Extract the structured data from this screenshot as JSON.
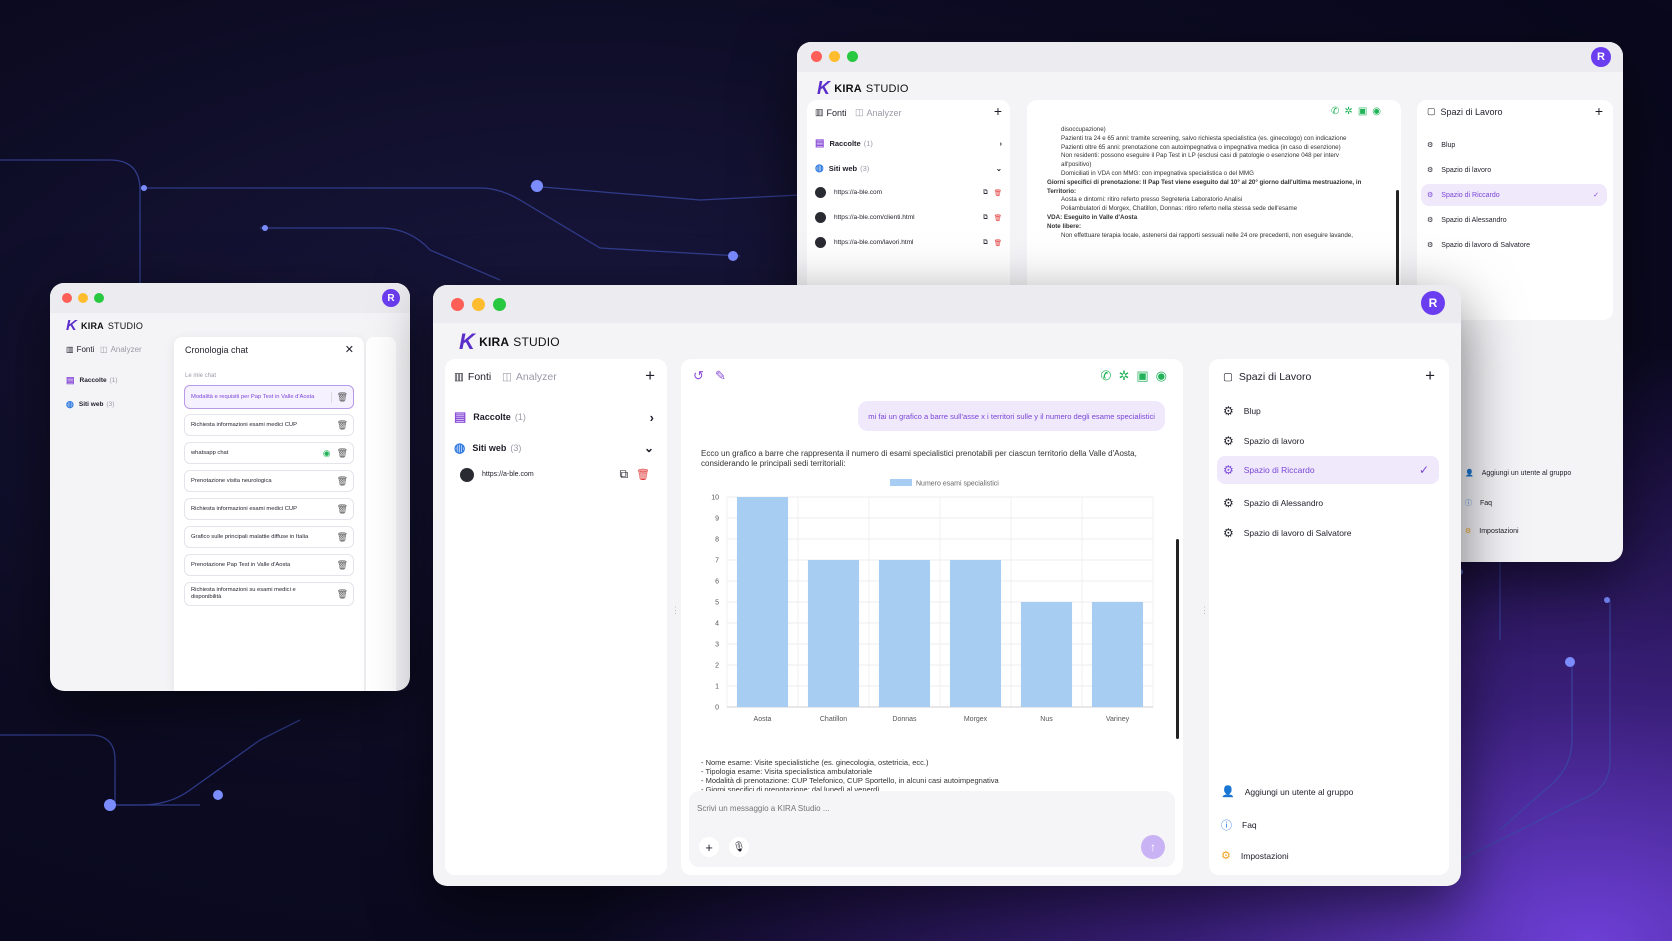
{
  "brand": {
    "name": "KIRA",
    "suffix": "STUDIO",
    "avatar": "R"
  },
  "colors": {
    "accent": "#6b3df0",
    "bar": "#a7cdf3",
    "selected_bg": "#efe9fb",
    "selected_text": "#7a45d8"
  },
  "left_panel": {
    "tab_sources": "Fonti",
    "tab_analyzer": "Analyzer",
    "collections_label": "Raccolte",
    "collections_count": "(1)",
    "websites_label": "Siti web",
    "websites_count": "(3)",
    "websites": [
      "https://a-ble.com",
      "https://a-ble.com/clienti.html",
      "https://a-ble.com/lavori.html"
    ]
  },
  "workspaces": {
    "title": "Spazi di Lavoro",
    "items": [
      "Blup",
      "Spazio di lavoro",
      "Spazio di Riccardo",
      "Spazio di Alessandro",
      "Spazio di lavoro di Salvatore"
    ],
    "selected": "Spazio di Riccardo",
    "add_user": "Aggiungi un utente al gruppo",
    "faq": "Faq",
    "settings": "Impostazioni"
  },
  "history": {
    "title": "Cronologia chat",
    "section": "Le mie chat",
    "items": [
      "Modalità e requisiti per Pap Test in Valle d'Aosta",
      "Richiesta informazioni esami medici CUP",
      "whatsapp chat",
      "Prenotazione visita neurologica",
      "Richiesta informazioni esami medici CUP",
      "Grafico sulle principali malattie diffuse in Italia",
      "Prenotazione Pap Test in Valle d'Aosta",
      "Richiesta informazioni su esami medici e disponibilità"
    ]
  },
  "back_chat": {
    "lines": [
      "disoccupazione)",
      "Pazienti tra 24 e 65 anni: tramite screening, salvo richiesta specialistica (es. ginecologo) con indicazione",
      "Pazienti oltre 65 anni: prenotazione con autoimpegnativa o impegnativa medica (in caso di esenzione)",
      "Non residenti: possono eseguire il Pap Test in LP (esclusi casi di patologie o esenzione 048 per interv",
      "all'positivo)",
      "Domiciliati in VDA con MMG: con impegnativa specialistica o del MMG",
      "Giorni specifici di prenotazione: Il Pap Test viene eseguito dal 10° al 20° giorno dall'ultima mestruazione, in",
      "Territorio:",
      "Aosta e dintorni: ritiro referto presso Segreteria Laboratorio Analisi",
      "Poliambulatori di Morgex, Chatillon, Donnas: ritiro referto nella stessa sede dell'esame",
      "VDA: Eseguito in Valle d'Aosta",
      "Note libere:",
      "Non effettuare terapia locale, astenersi dai rapporti sessuali nelle 24 ore precedenti, non eseguire lavande,"
    ]
  },
  "chat": {
    "user_message": "mi fai un grafico a barre sull'asse x i territori sulle y il numero degli esame specialistici",
    "intro": "Ecco un grafico a barre che rappresenta il numero di esami specialistici prenotabili per ciascun territorio della Valle d'Aosta, considerando le principali sedi territoriali:",
    "notes": [
      "- Nome esame: Visite specialistiche (es. ginecologia, ostetricia, ecc.)",
      "- Tipologia esame: Visita specialistica ambulatoriale",
      "- Modalità di prenotazione: CUP Telefonico, CUP Sportello, in alcuni casi autoimpegnativa",
      "- Giorni specifici di prenotazione: dal lunedì al venerdì"
    ],
    "input_placeholder": "Scrivi un messaggio a KIRA Studio ..."
  },
  "chart_data": {
    "type": "bar",
    "categories": [
      "Aosta",
      "Chatillon",
      "Donnas",
      "Morgex",
      "Nus",
      "Variney"
    ],
    "series": [
      {
        "name": "Numero esami specialistici",
        "values": [
          10,
          7,
          7,
          7,
          5,
          5
        ]
      }
    ],
    "ylim": [
      0,
      10
    ],
    "yticks": [
      "0",
      "1",
      "2",
      "3",
      "4",
      "5",
      "6",
      "7",
      "8",
      "9",
      "10"
    ],
    "grid": true,
    "legend": "top-center"
  }
}
